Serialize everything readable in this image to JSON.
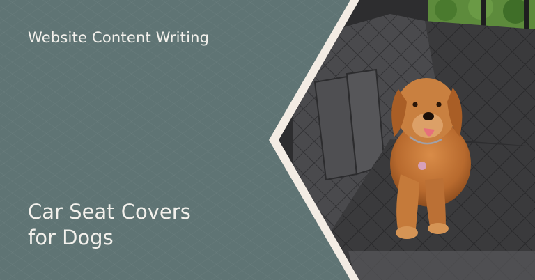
{
  "banner": {
    "category": "Website Content Writing",
    "title_lines": [
      "Car Seat Covers",
      "for Dogs"
    ]
  },
  "image": {
    "subject": "golden-retriever-on-car-seat-cover"
  },
  "colors": {
    "panel": "#5f7474",
    "divider": "#f3ece4",
    "text": "#f3f1ec",
    "seat_cover": "#3b3b3d",
    "dog": "#c67a3c"
  }
}
